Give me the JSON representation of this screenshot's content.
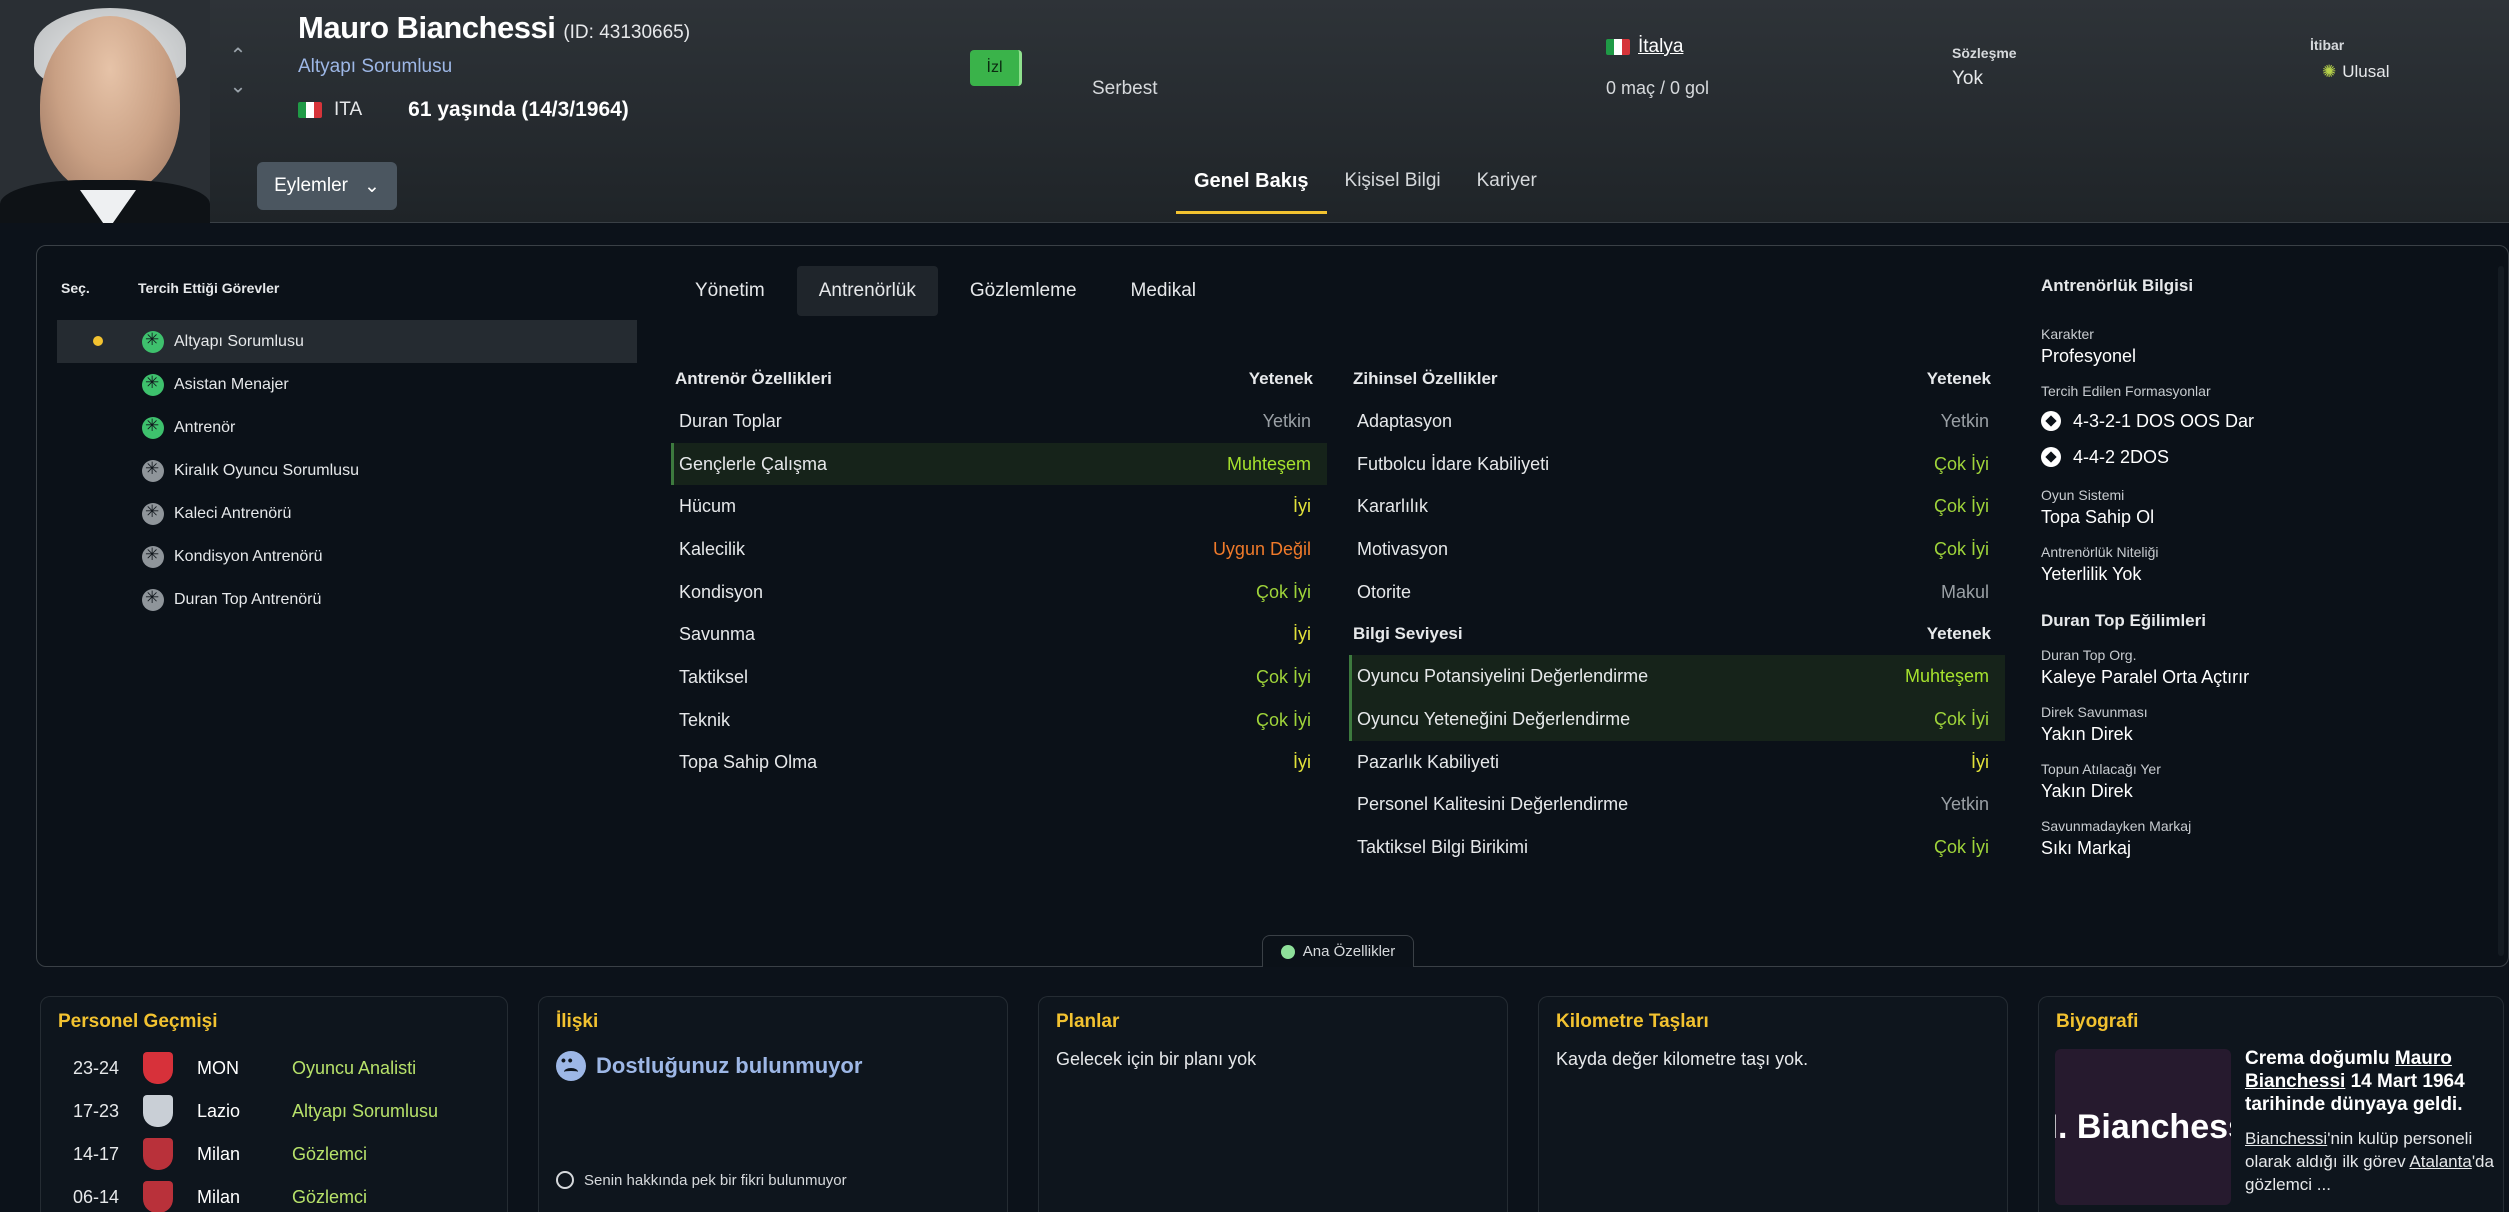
{
  "header": {
    "name": "Mauro Bianchessi",
    "id_text": "(ID: 43130665)",
    "role": "Altyapı Sorumlusu",
    "nation_code": "ITA",
    "age": "61 yaşında (14/3/1964)",
    "actions_label": "Eylemler",
    "follow_label": "İzl",
    "status": "Serbest",
    "country": "İtalya",
    "apps": "0 maç / 0 gol",
    "contract_label": "Sözleşme",
    "contract_value": "Yok",
    "reputation_label": "İtibar",
    "reputation_value": "Ulusal",
    "tabs": [
      "Genel Bakış",
      "Kişisel Bilgi",
      "Kariyer"
    ]
  },
  "duties": {
    "col_select": "Seç.",
    "col_duties": "Tercih Ettiği Görevler",
    "items": [
      {
        "label": "Altyapı Sorumlusu",
        "selected": true,
        "preferred": true
      },
      {
        "label": "Asistan Menajer",
        "selected": false,
        "preferred": true
      },
      {
        "label": "Antrenör",
        "selected": false,
        "preferred": true
      },
      {
        "label": "Kiralık Oyuncu Sorumlusu",
        "selected": false,
        "preferred": false
      },
      {
        "label": "Kaleci Antrenörü",
        "selected": false,
        "preferred": false
      },
      {
        "label": "Kondisyon Antrenörü",
        "selected": false,
        "preferred": false
      },
      {
        "label": "Duran Top Antrenörü",
        "selected": false,
        "preferred": false
      }
    ]
  },
  "subtabs": [
    "Yönetim",
    "Antrenörlük",
    "Gözlemleme",
    "Medikal"
  ],
  "coach_attrs": {
    "title": "Antrenör Özellikleri",
    "col": "Yetenek",
    "rows": [
      {
        "label": "Duran Toplar",
        "value": "Yetkin",
        "cls": "v-yetkin",
        "hl": false
      },
      {
        "label": "Gençlerle Çalışma",
        "value": "Muhteşem",
        "cls": "v-muhtesem",
        "hl": true
      },
      {
        "label": "Hücum",
        "value": "İyi",
        "cls": "v-iyi",
        "hl": false
      },
      {
        "label": "Kalecilik",
        "value": "Uygun Değil",
        "cls": "v-uygun",
        "hl": false
      },
      {
        "label": "Kondisyon",
        "value": "Çok İyi",
        "cls": "v-cokiyi",
        "hl": false
      },
      {
        "label": "Savunma",
        "value": "İyi",
        "cls": "v-iyi",
        "hl": false
      },
      {
        "label": "Taktiksel",
        "value": "Çok İyi",
        "cls": "v-cokiyi",
        "hl": false
      },
      {
        "label": "Teknik",
        "value": "Çok İyi",
        "cls": "v-cokiyi",
        "hl": false
      },
      {
        "label": "Topa Sahip Olma",
        "value": "İyi",
        "cls": "v-iyi",
        "hl": false
      }
    ]
  },
  "mental_attrs": {
    "title": "Zihinsel Özellikler",
    "col": "Yetenek",
    "rows": [
      {
        "label": "Adaptasyon",
        "value": "Yetkin",
        "cls": "v-yetkin",
        "hl": false
      },
      {
        "label": "Futbolcu İdare Kabiliyeti",
        "value": "Çok İyi",
        "cls": "v-cokiyi",
        "hl": false
      },
      {
        "label": "Kararlılık",
        "value": "Çok İyi",
        "cls": "v-cokiyi",
        "hl": false
      },
      {
        "label": "Motivasyon",
        "value": "Çok İyi",
        "cls": "v-cokiyi",
        "hl": false
      },
      {
        "label": "Otorite",
        "value": "Makul",
        "cls": "v-makul",
        "hl": false
      }
    ]
  },
  "knowledge_attrs": {
    "title": "Bilgi Seviyesi",
    "col": "Yetenek",
    "rows": [
      {
        "label": "Oyuncu Potansiyelini Değerlendirme",
        "value": "Muhteşem",
        "cls": "v-muhtesem",
        "hl": true
      },
      {
        "label": "Oyuncu Yeteneğini Değerlendirme",
        "value": "Çok İyi",
        "cls": "v-cokiyi",
        "hl": true
      },
      {
        "label": "Pazarlık Kabiliyeti",
        "value": "İyi",
        "cls": "v-iyi",
        "hl": false
      },
      {
        "label": "Personel Kalitesini Değerlendirme",
        "value": "Yetkin",
        "cls": "v-yetkin",
        "hl": false
      },
      {
        "label": "Taktiksel Bilgi Birikimi",
        "value": "Çok İyi",
        "cls": "v-cokiyi",
        "hl": false
      }
    ]
  },
  "coach_info": {
    "title": "Antrenörlük Bilgisi",
    "character_label": "Karakter",
    "character_value": "Profesyonel",
    "formations_label": "Tercih Edilen Formasyonlar",
    "formations": [
      "4-3-2-1 DOS OOS Dar",
      "4-4-2 2DOS"
    ],
    "system_label": "Oyun Sistemi",
    "system_value": "Topa Sahip Ol",
    "qual_label": "Antrenörlük Niteliği",
    "qual_value": "Yeterlilik Yok",
    "setpiece_title": "Duran Top Eğilimleri",
    "setpiece": [
      {
        "label": "Duran Top Org.",
        "value": "Kaleye Paralel Orta Açtırır"
      },
      {
        "label": "Direk Savunması",
        "value": "Yakın Direk"
      },
      {
        "label": "Topun Atılacağı Yer",
        "value": "Yakın Direk"
      },
      {
        "label": "Savunmadayken Markaj",
        "value": "Sıkı Markaj"
      }
    ]
  },
  "ana_btn": "Ana Özellikler",
  "history": {
    "title": "Personel Geçmişi",
    "rows": [
      {
        "years": "23-24",
        "club": "MON",
        "role": "Oyuncu Analisti",
        "crest": "#d7313a"
      },
      {
        "years": "17-23",
        "club": "Lazio",
        "role": "Altyapı Sorumlusu",
        "crest": "#c9cfd6"
      },
      {
        "years": "14-17",
        "club": "Milan",
        "role": "Gözlemci",
        "crest": "#b9313a"
      },
      {
        "years": "06-14",
        "club": "Milan",
        "role": "Gözlemci",
        "crest": "#b9313a"
      }
    ]
  },
  "relation": {
    "title": "İlişki",
    "headline": "Dostluğunuz bulunmuyor",
    "footer": "Senin hakkında pek bir fikri bulunmuyor"
  },
  "plans": {
    "title": "Planlar",
    "text": "Gelecek için bir planı yok"
  },
  "milestones": {
    "title": "Kilometre Taşları",
    "text": "Kayda değer kilometre taşı yok."
  },
  "bio": {
    "title": "Biyografi",
    "image_text": "M. Bianchessi",
    "lead_1": "Crema doğumlu ",
    "lead_name": "Mauro Bianchessi",
    "lead_2": " 14 Mart 1964 tarihinde dünyaya geldi.",
    "body_name": "Bianchessi",
    "body_1": "'nin kulüp personeli olarak aldığı ilk görev ",
    "body_club": "Atalanta",
    "body_2": "'da gözlemci ..."
  }
}
